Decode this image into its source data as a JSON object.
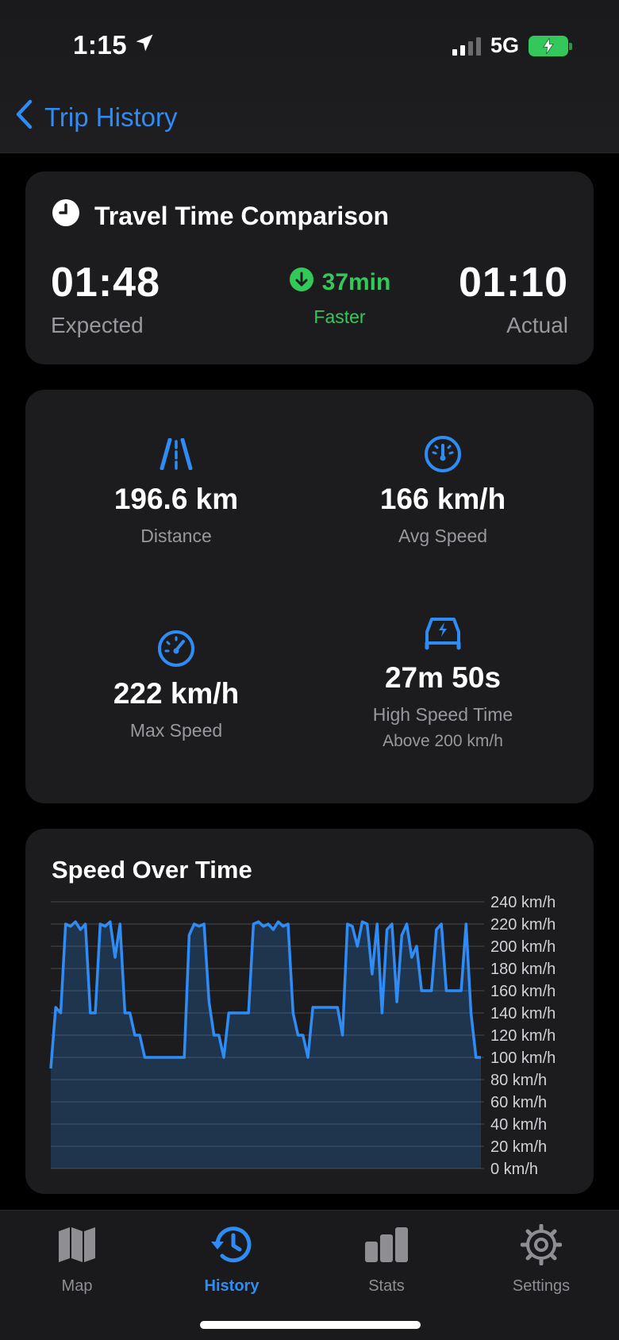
{
  "status": {
    "time": "1:15",
    "network": "5G"
  },
  "nav": {
    "back_label": "Trip History"
  },
  "travel": {
    "title": "Travel Time Comparison",
    "expected_value": "01:48",
    "expected_label": "Expected",
    "actual_value": "01:10",
    "actual_label": "Actual",
    "delta_value": "37min",
    "delta_label": "Faster"
  },
  "stats": {
    "distance": {
      "value": "196.6 km",
      "label": "Distance"
    },
    "avg_speed": {
      "value": "166 km/h",
      "label": "Avg Speed"
    },
    "max_speed": {
      "value": "222 km/h",
      "label": "Max Speed"
    },
    "high_speed": {
      "value": "27m 50s",
      "label": "High Speed Time",
      "sub": "Above 200 km/h"
    }
  },
  "chart_data": {
    "type": "area",
    "title": "Speed Over Time",
    "ylim": [
      0,
      240
    ],
    "y_ticks": [
      "240 km/h",
      "220 km/h",
      "200 km/h",
      "180 km/h",
      "160 km/h",
      "140 km/h",
      "120 km/h",
      "100 km/h",
      "80 km/h",
      "60 km/h",
      "40 km/h",
      "20 km/h",
      "0 km/h"
    ],
    "grid": true,
    "series": [
      {
        "values": [
          90,
          145,
          140,
          220,
          218,
          222,
          215,
          220,
          140,
          140,
          220,
          218,
          222,
          190,
          220,
          140,
          140,
          120,
          120,
          100,
          100,
          100,
          100,
          100,
          100,
          100,
          100,
          100,
          210,
          220,
          218,
          220,
          150,
          120,
          120,
          100,
          140,
          140,
          140,
          140,
          140,
          220,
          222,
          218,
          220,
          215,
          222,
          218,
          220,
          140,
          120,
          120,
          100,
          145,
          145,
          145,
          145,
          145,
          145,
          120,
          220,
          218,
          200,
          222,
          220,
          175,
          220,
          140,
          215,
          220,
          150,
          210,
          220,
          190,
          200,
          160,
          160,
          160,
          215,
          220,
          160,
          160,
          160,
          160,
          220,
          140,
          100,
          100
        ]
      }
    ],
    "line_color": "#2f8cf5"
  },
  "tabs": [
    {
      "label": "Map",
      "icon": "map-icon"
    },
    {
      "label": "History",
      "icon": "history-icon"
    },
    {
      "label": "Stats",
      "icon": "stats-icon"
    },
    {
      "label": "Settings",
      "icon": "gear-icon"
    }
  ]
}
